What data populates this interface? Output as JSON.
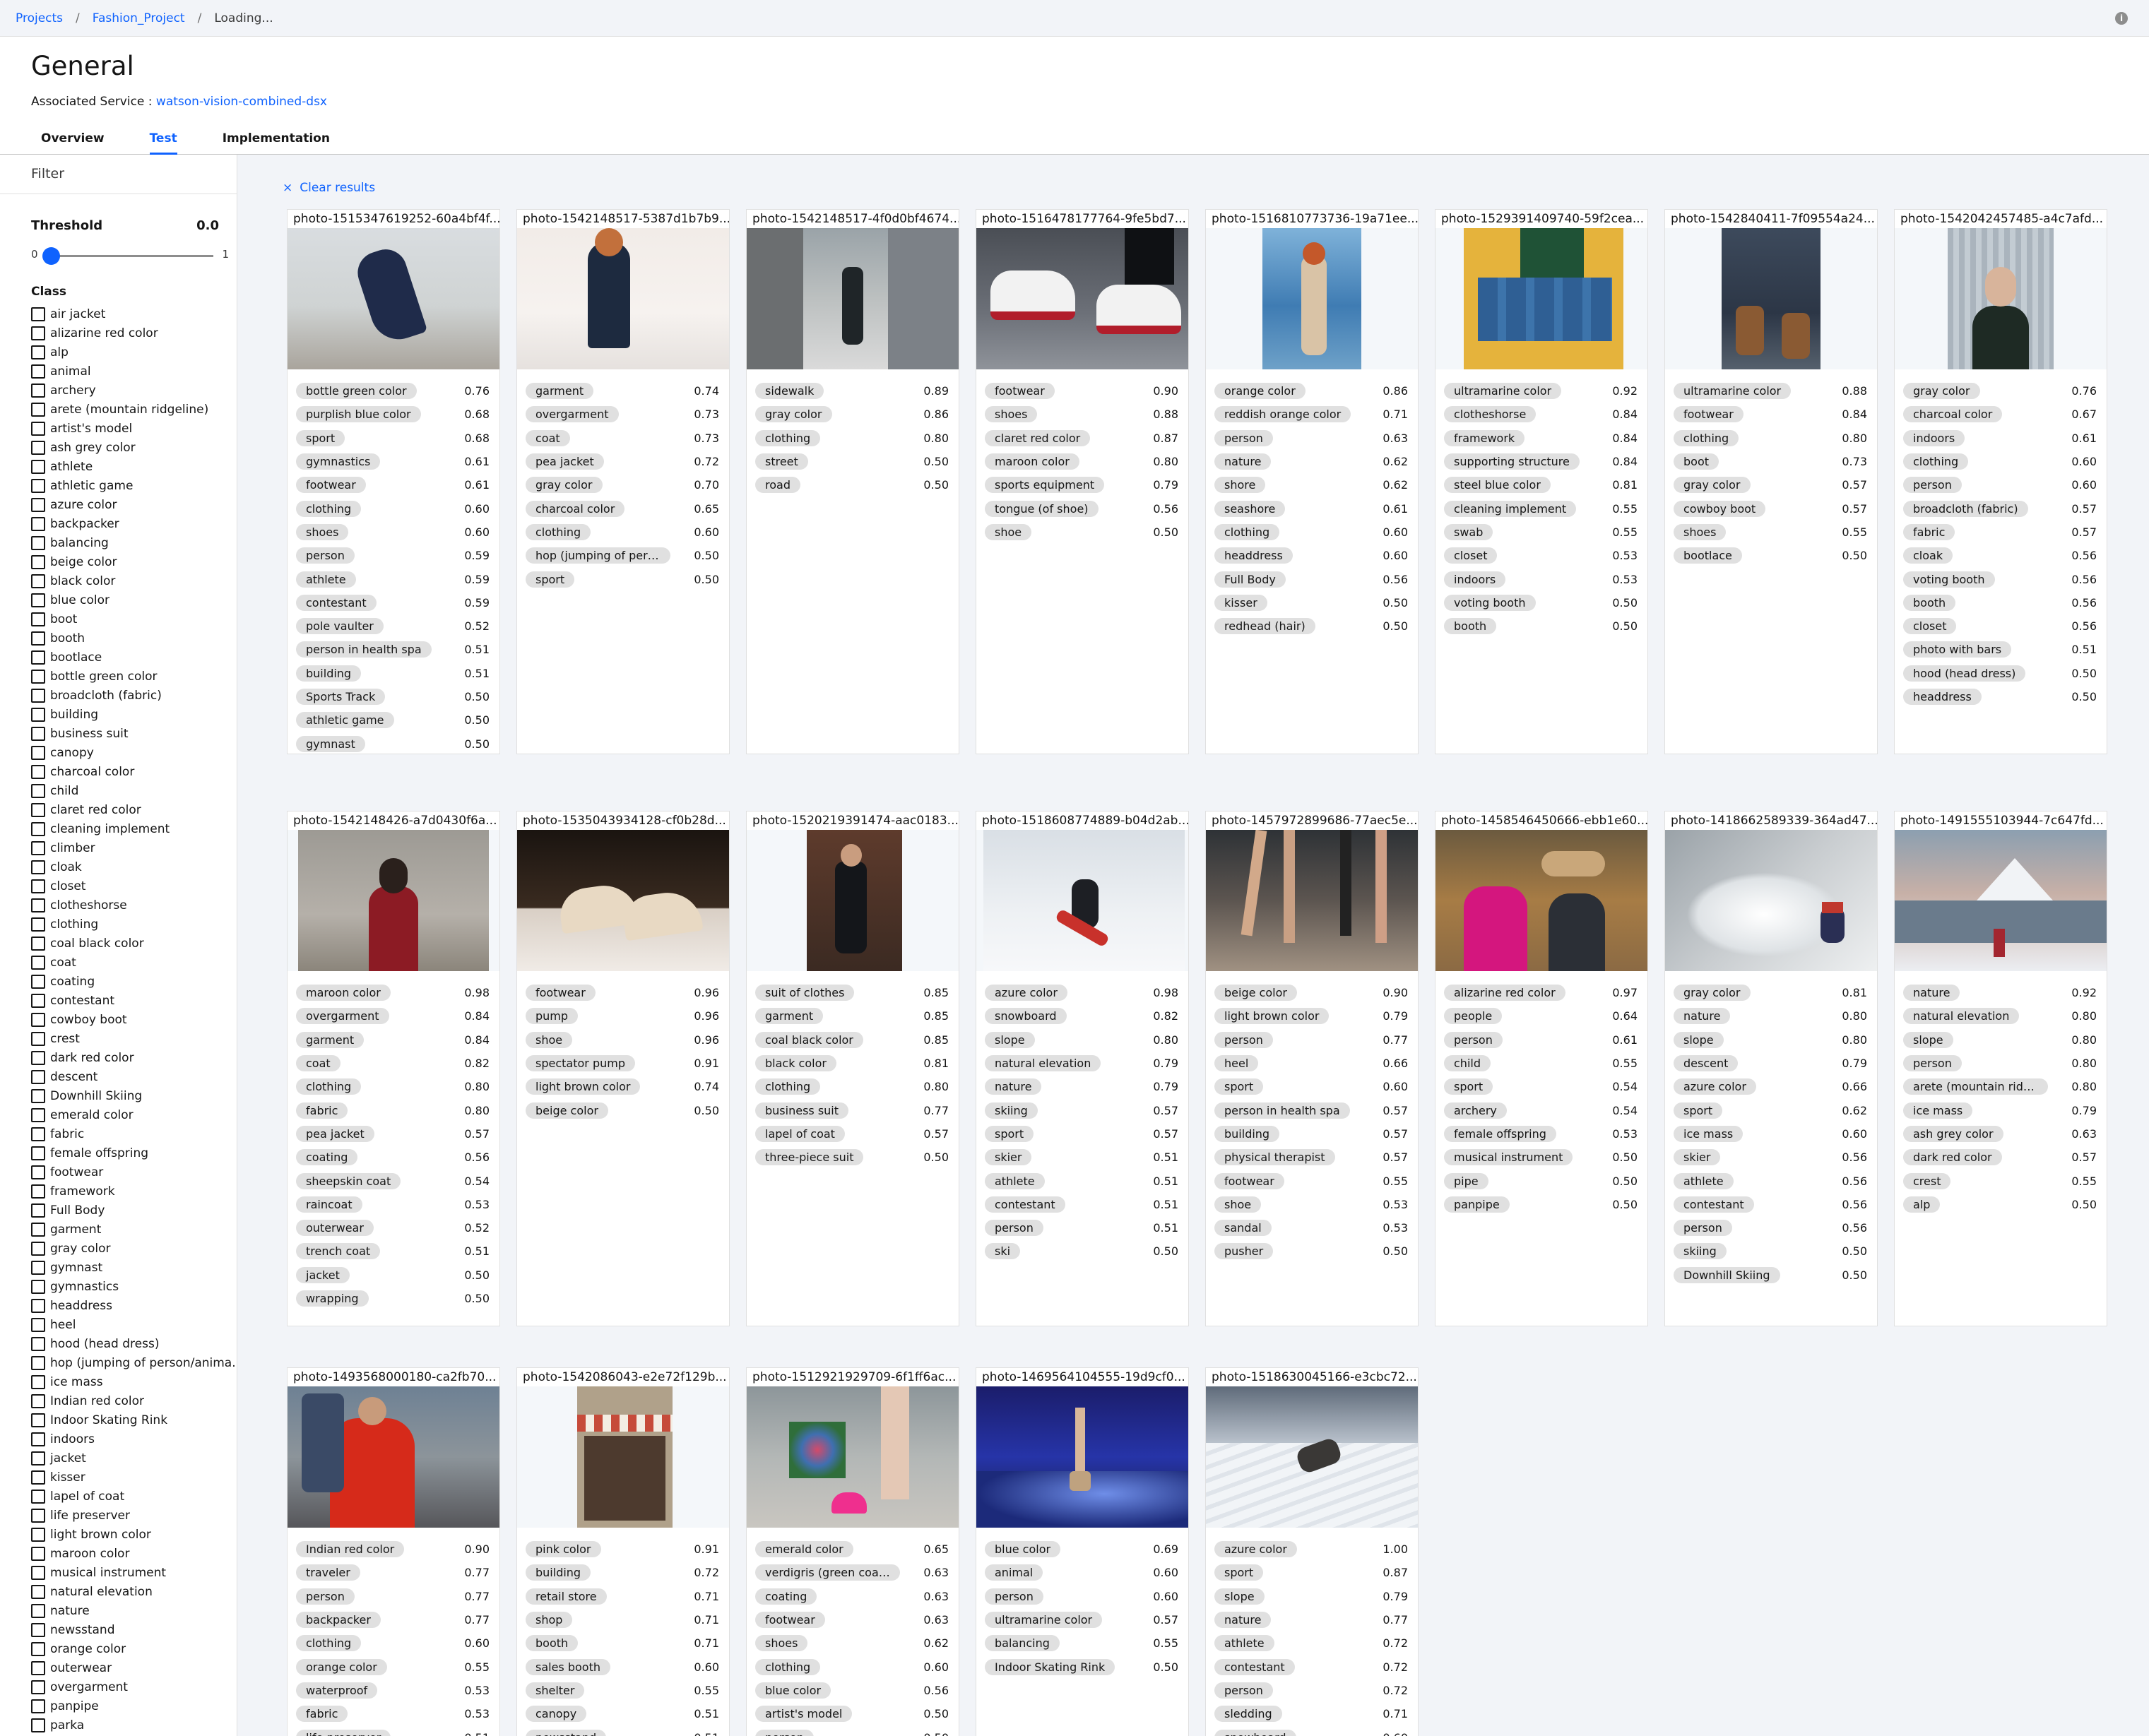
{
  "breadcrumb": [
    "Projects",
    "Fashion_Project",
    "Loading..."
  ],
  "info_icon_glyph": "i",
  "page_title": "General",
  "associated_label": "Associated Service : ",
  "associated_link": "watson-vision-combined-dsx",
  "tabs": [
    "Overview",
    "Test",
    "Implementation"
  ],
  "sidebar": {
    "filter_label": "Filter",
    "threshold_label": "Threshold",
    "threshold_value": "0.0",
    "slider_min": "0",
    "slider_max": "1",
    "class_title": "Class",
    "classes": [
      "air jacket",
      "alizarine red color",
      "alp",
      "animal",
      "archery",
      "arete (mountain ridgeline)",
      "artist's model",
      "ash grey color",
      "athlete",
      "athletic game",
      "azure color",
      "backpacker",
      "balancing",
      "beige color",
      "black color",
      "blue color",
      "boot",
      "booth",
      "bootlace",
      "bottle green color",
      "broadcloth (fabric)",
      "building",
      "business suit",
      "canopy",
      "charcoal color",
      "child",
      "claret red color",
      "cleaning implement",
      "climber",
      "cloak",
      "closet",
      "clotheshorse",
      "clothing",
      "coal black color",
      "coat",
      "coating",
      "contestant",
      "cowboy boot",
      "crest",
      "dark red color",
      "descent",
      "Downhill Skiing",
      "emerald color",
      "fabric",
      "female offspring",
      "footwear",
      "framework",
      "Full Body",
      "garment",
      "gray color",
      "gymnast",
      "gymnastics",
      "headdress",
      "heel",
      "hood (head dress)",
      "hop (jumping of person/anima...",
      "ice mass",
      "Indian red color",
      "Indoor Skating Rink",
      "indoors",
      "jacket",
      "kisser",
      "lapel of coat",
      "life preserver",
      "light brown color",
      "maroon color",
      "musical instrument",
      "natural elevation",
      "nature",
      "newsstand",
      "orange color",
      "outerwear",
      "overgarment",
      "panpipe",
      "parka"
    ]
  },
  "clear_results": "Clear results",
  "clear_icon": "×",
  "cards": [
    {
      "title": "photo-1515347619252-60a4bf4f...",
      "image": "navy-heels-hanging",
      "tags": [
        [
          "bottle green color",
          "0.76"
        ],
        [
          "purplish blue color",
          "0.68"
        ],
        [
          "sport",
          "0.68"
        ],
        [
          "gymnastics",
          "0.61"
        ],
        [
          "footwear",
          "0.61"
        ],
        [
          "clothing",
          "0.60"
        ],
        [
          "shoes",
          "0.60"
        ],
        [
          "person",
          "0.59"
        ],
        [
          "athlete",
          "0.59"
        ],
        [
          "contestant",
          "0.59"
        ],
        [
          "pole vaulter",
          "0.52"
        ],
        [
          "person in health spa",
          "0.51"
        ],
        [
          "building",
          "0.51"
        ],
        [
          "Sports Track",
          "0.50"
        ],
        [
          "athletic game",
          "0.50"
        ],
        [
          "gymnast",
          "0.50"
        ]
      ]
    },
    {
      "title": "photo-1542148517-5387d1b7b9...",
      "image": "woman-snow-coat",
      "tags": [
        [
          "garment",
          "0.74"
        ],
        [
          "overgarment",
          "0.73"
        ],
        [
          "coat",
          "0.73"
        ],
        [
          "pea jacket",
          "0.72"
        ],
        [
          "gray color",
          "0.70"
        ],
        [
          "charcoal color",
          "0.65"
        ],
        [
          "clothing",
          "0.60"
        ],
        [
          "hop (jumping of person/...",
          "0.50"
        ],
        [
          "sport",
          "0.50"
        ]
      ]
    },
    {
      "title": "photo-1542148517-4f0d0bf4674...",
      "image": "woman-sidewalk",
      "tags": [
        [
          "sidewalk",
          "0.89"
        ],
        [
          "gray color",
          "0.86"
        ],
        [
          "clothing",
          "0.80"
        ],
        [
          "street",
          "0.50"
        ],
        [
          "road",
          "0.50"
        ]
      ]
    },
    {
      "title": "photo-1516478177764-9fe5bd7...",
      "image": "red-sneakers",
      "tags": [
        [
          "footwear",
          "0.90"
        ],
        [
          "shoes",
          "0.88"
        ],
        [
          "claret red color",
          "0.87"
        ],
        [
          "maroon color",
          "0.80"
        ],
        [
          "sports equipment",
          "0.79"
        ],
        [
          "tongue (of shoe)",
          "0.56"
        ],
        [
          "shoe",
          "0.50"
        ]
      ]
    },
    {
      "title": "photo-1516810773736-19a71ee...",
      "image": "woman-seaside",
      "tags": [
        [
          "orange color",
          "0.86"
        ],
        [
          "reddish orange color",
          "0.71"
        ],
        [
          "person",
          "0.63"
        ],
        [
          "nature",
          "0.62"
        ],
        [
          "shore",
          "0.62"
        ],
        [
          "seashore",
          "0.61"
        ],
        [
          "clothing",
          "0.60"
        ],
        [
          "headdress",
          "0.60"
        ],
        [
          "Full Body",
          "0.56"
        ],
        [
          "kisser",
          "0.50"
        ],
        [
          "redhead (hair)",
          "0.50"
        ]
      ]
    },
    {
      "title": "photo-1529391409740-59f2cea...",
      "image": "jeans-clothesline",
      "tags": [
        [
          "ultramarine color",
          "0.92"
        ],
        [
          "clotheshorse",
          "0.84"
        ],
        [
          "framework",
          "0.84"
        ],
        [
          "supporting structure",
          "0.84"
        ],
        [
          "steel blue color",
          "0.81"
        ],
        [
          "cleaning implement",
          "0.55"
        ],
        [
          "swab",
          "0.55"
        ],
        [
          "closet",
          "0.53"
        ],
        [
          "indoors",
          "0.53"
        ],
        [
          "voting booth",
          "0.50"
        ],
        [
          "booth",
          "0.50"
        ]
      ]
    },
    {
      "title": "photo-1542840411-7f09554a24...",
      "image": "boots-jeans",
      "tags": [
        [
          "ultramarine color",
          "0.88"
        ],
        [
          "footwear",
          "0.84"
        ],
        [
          "clothing",
          "0.80"
        ],
        [
          "boot",
          "0.73"
        ],
        [
          "gray color",
          "0.57"
        ],
        [
          "cowboy boot",
          "0.57"
        ],
        [
          "shoes",
          "0.55"
        ],
        [
          "bootlace",
          "0.50"
        ]
      ]
    },
    {
      "title": "photo-1542042457485-a4c7afd...",
      "image": "man-portrait",
      "tags": [
        [
          "gray color",
          "0.76"
        ],
        [
          "charcoal color",
          "0.67"
        ],
        [
          "indoors",
          "0.61"
        ],
        [
          "clothing",
          "0.60"
        ],
        [
          "person",
          "0.60"
        ],
        [
          "broadcloth (fabric)",
          "0.57"
        ],
        [
          "fabric",
          "0.57"
        ],
        [
          "cloak",
          "0.56"
        ],
        [
          "voting booth",
          "0.56"
        ],
        [
          "booth",
          "0.56"
        ],
        [
          "closet",
          "0.56"
        ],
        [
          "photo with bars",
          "0.51"
        ],
        [
          "hood (head dress)",
          "0.50"
        ],
        [
          "headdress",
          "0.50"
        ]
      ]
    },
    {
      "title": "photo-1542148426-a7d0430f6a...",
      "image": "woman-red-coat",
      "tags": [
        [
          "maroon color",
          "0.98"
        ],
        [
          "overgarment",
          "0.84"
        ],
        [
          "garment",
          "0.84"
        ],
        [
          "coat",
          "0.82"
        ],
        [
          "clothing",
          "0.80"
        ],
        [
          "fabric",
          "0.80"
        ],
        [
          "pea jacket",
          "0.57"
        ],
        [
          "coating",
          "0.56"
        ],
        [
          "sheepskin coat",
          "0.54"
        ],
        [
          "raincoat",
          "0.53"
        ],
        [
          "outerwear",
          "0.52"
        ],
        [
          "trench coat",
          "0.51"
        ],
        [
          "jacket",
          "0.50"
        ],
        [
          "wrapping",
          "0.50"
        ]
      ]
    },
    {
      "title": "photo-1535043934128-cf0b28d...",
      "image": "beige-pumps",
      "tags": [
        [
          "footwear",
          "0.96"
        ],
        [
          "pump",
          "0.96"
        ],
        [
          "shoe",
          "0.96"
        ],
        [
          "spectator pump",
          "0.91"
        ],
        [
          "light brown color",
          "0.74"
        ],
        [
          "beige color",
          "0.50"
        ]
      ]
    },
    {
      "title": "photo-1520219391474-aac0183...",
      "image": "man-suit",
      "tags": [
        [
          "suit of clothes",
          "0.85"
        ],
        [
          "garment",
          "0.85"
        ],
        [
          "coal black color",
          "0.85"
        ],
        [
          "black color",
          "0.81"
        ],
        [
          "clothing",
          "0.80"
        ],
        [
          "business suit",
          "0.77"
        ],
        [
          "lapel of coat",
          "0.57"
        ],
        [
          "three-piece suit",
          "0.50"
        ]
      ]
    },
    {
      "title": "photo-1518608774889-b04d2ab...",
      "image": "snowboarder",
      "tags": [
        [
          "azure color",
          "0.98"
        ],
        [
          "snowboard",
          "0.82"
        ],
        [
          "slope",
          "0.80"
        ],
        [
          "natural elevation",
          "0.79"
        ],
        [
          "nature",
          "0.79"
        ],
        [
          "skiing",
          "0.57"
        ],
        [
          "sport",
          "0.57"
        ],
        [
          "skier",
          "0.51"
        ],
        [
          "athlete",
          "0.51"
        ],
        [
          "contestant",
          "0.51"
        ],
        [
          "person",
          "0.51"
        ],
        [
          "ski",
          "0.50"
        ]
      ]
    },
    {
      "title": "photo-1457972899686-77aec5e...",
      "image": "legs-heels",
      "tags": [
        [
          "beige color",
          "0.90"
        ],
        [
          "light brown color",
          "0.79"
        ],
        [
          "person",
          "0.77"
        ],
        [
          "heel",
          "0.66"
        ],
        [
          "sport",
          "0.60"
        ],
        [
          "person in health spa",
          "0.57"
        ],
        [
          "building",
          "0.57"
        ],
        [
          "physical therapist",
          "0.57"
        ],
        [
          "footwear",
          "0.55"
        ],
        [
          "shoe",
          "0.53"
        ],
        [
          "sandal",
          "0.53"
        ],
        [
          "pusher",
          "0.50"
        ]
      ]
    },
    {
      "title": "photo-1458546450666-ebb1e60...",
      "image": "kids-selfie",
      "tags": [
        [
          "alizarine red color",
          "0.97"
        ],
        [
          "people",
          "0.64"
        ],
        [
          "person",
          "0.61"
        ],
        [
          "child",
          "0.55"
        ],
        [
          "sport",
          "0.54"
        ],
        [
          "archery",
          "0.54"
        ],
        [
          "female offspring",
          "0.53"
        ],
        [
          "musical instrument",
          "0.50"
        ],
        [
          "pipe",
          "0.50"
        ],
        [
          "panpipe",
          "0.50"
        ]
      ]
    },
    {
      "title": "photo-1418662589339-364ad47...",
      "image": "skier-powder",
      "tags": [
        [
          "gray color",
          "0.81"
        ],
        [
          "nature",
          "0.80"
        ],
        [
          "slope",
          "0.80"
        ],
        [
          "descent",
          "0.79"
        ],
        [
          "azure color",
          "0.66"
        ],
        [
          "sport",
          "0.62"
        ],
        [
          "ice mass",
          "0.60"
        ],
        [
          "skier",
          "0.56"
        ],
        [
          "athlete",
          "0.56"
        ],
        [
          "contestant",
          "0.56"
        ],
        [
          "person",
          "0.56"
        ],
        [
          "skiing",
          "0.50"
        ],
        [
          "Downhill Skiing",
          "0.50"
        ]
      ]
    },
    {
      "title": "photo-1491555103944-7c647fd...",
      "image": "mountain-hiker",
      "tags": [
        [
          "nature",
          "0.92"
        ],
        [
          "natural elevation",
          "0.80"
        ],
        [
          "slope",
          "0.80"
        ],
        [
          "person",
          "0.80"
        ],
        [
          "arete (mountain ridgeline)",
          "0.80"
        ],
        [
          "ice mass",
          "0.79"
        ],
        [
          "ash grey color",
          "0.63"
        ],
        [
          "dark red color",
          "0.57"
        ],
        [
          "crest",
          "0.55"
        ],
        [
          "alp",
          "0.50"
        ]
      ]
    },
    {
      "title": "photo-1493568000180-ca2fb70...",
      "image": "climber-red-jacket",
      "tags": [
        [
          "Indian red color",
          "0.90"
        ],
        [
          "traveler",
          "0.77"
        ],
        [
          "person",
          "0.77"
        ],
        [
          "backpacker",
          "0.77"
        ],
        [
          "clothing",
          "0.60"
        ],
        [
          "orange color",
          "0.55"
        ],
        [
          "waterproof",
          "0.53"
        ],
        [
          "fabric",
          "0.53"
        ],
        [
          "life preserver",
          "0.51"
        ]
      ]
    },
    {
      "title": "photo-1542086043-e2e72f129b...",
      "image": "storefront",
      "tags": [
        [
          "pink color",
          "0.91"
        ],
        [
          "building",
          "0.72"
        ],
        [
          "retail store",
          "0.71"
        ],
        [
          "shop",
          "0.71"
        ],
        [
          "booth",
          "0.71"
        ],
        [
          "sales booth",
          "0.60"
        ],
        [
          "shelter",
          "0.55"
        ],
        [
          "canopy",
          "0.51"
        ],
        [
          "newsstand",
          "0.51"
        ]
      ]
    },
    {
      "title": "photo-1512921929709-6f1ff6ac...",
      "image": "pink-heels-bouquet",
      "tags": [
        [
          "emerald color",
          "0.65"
        ],
        [
          "verdigris (green coating)",
          "0.63"
        ],
        [
          "coating",
          "0.63"
        ],
        [
          "footwear",
          "0.63"
        ],
        [
          "shoes",
          "0.62"
        ],
        [
          "clothing",
          "0.60"
        ],
        [
          "blue color",
          "0.56"
        ],
        [
          "artist's model",
          "0.50"
        ],
        [
          "person",
          "0.50"
        ]
      ]
    },
    {
      "title": "photo-1469564104555-19d9cf0...",
      "image": "stage-heels",
      "tags": [
        [
          "blue color",
          "0.69"
        ],
        [
          "animal",
          "0.60"
        ],
        [
          "person",
          "0.60"
        ],
        [
          "ultramarine color",
          "0.57"
        ],
        [
          "balancing",
          "0.55"
        ],
        [
          "Indoor Skating Rink",
          "0.50"
        ]
      ]
    },
    {
      "title": "photo-1518630045166-e3cbc72...",
      "image": "sledder-snow",
      "tags": [
        [
          "azure color",
          "1.00"
        ],
        [
          "sport",
          "0.87"
        ],
        [
          "slope",
          "0.79"
        ],
        [
          "nature",
          "0.77"
        ],
        [
          "athlete",
          "0.72"
        ],
        [
          "contestant",
          "0.72"
        ],
        [
          "person",
          "0.72"
        ],
        [
          "sledding",
          "0.71"
        ],
        [
          "snowboard",
          "0.60"
        ]
      ]
    }
  ]
}
